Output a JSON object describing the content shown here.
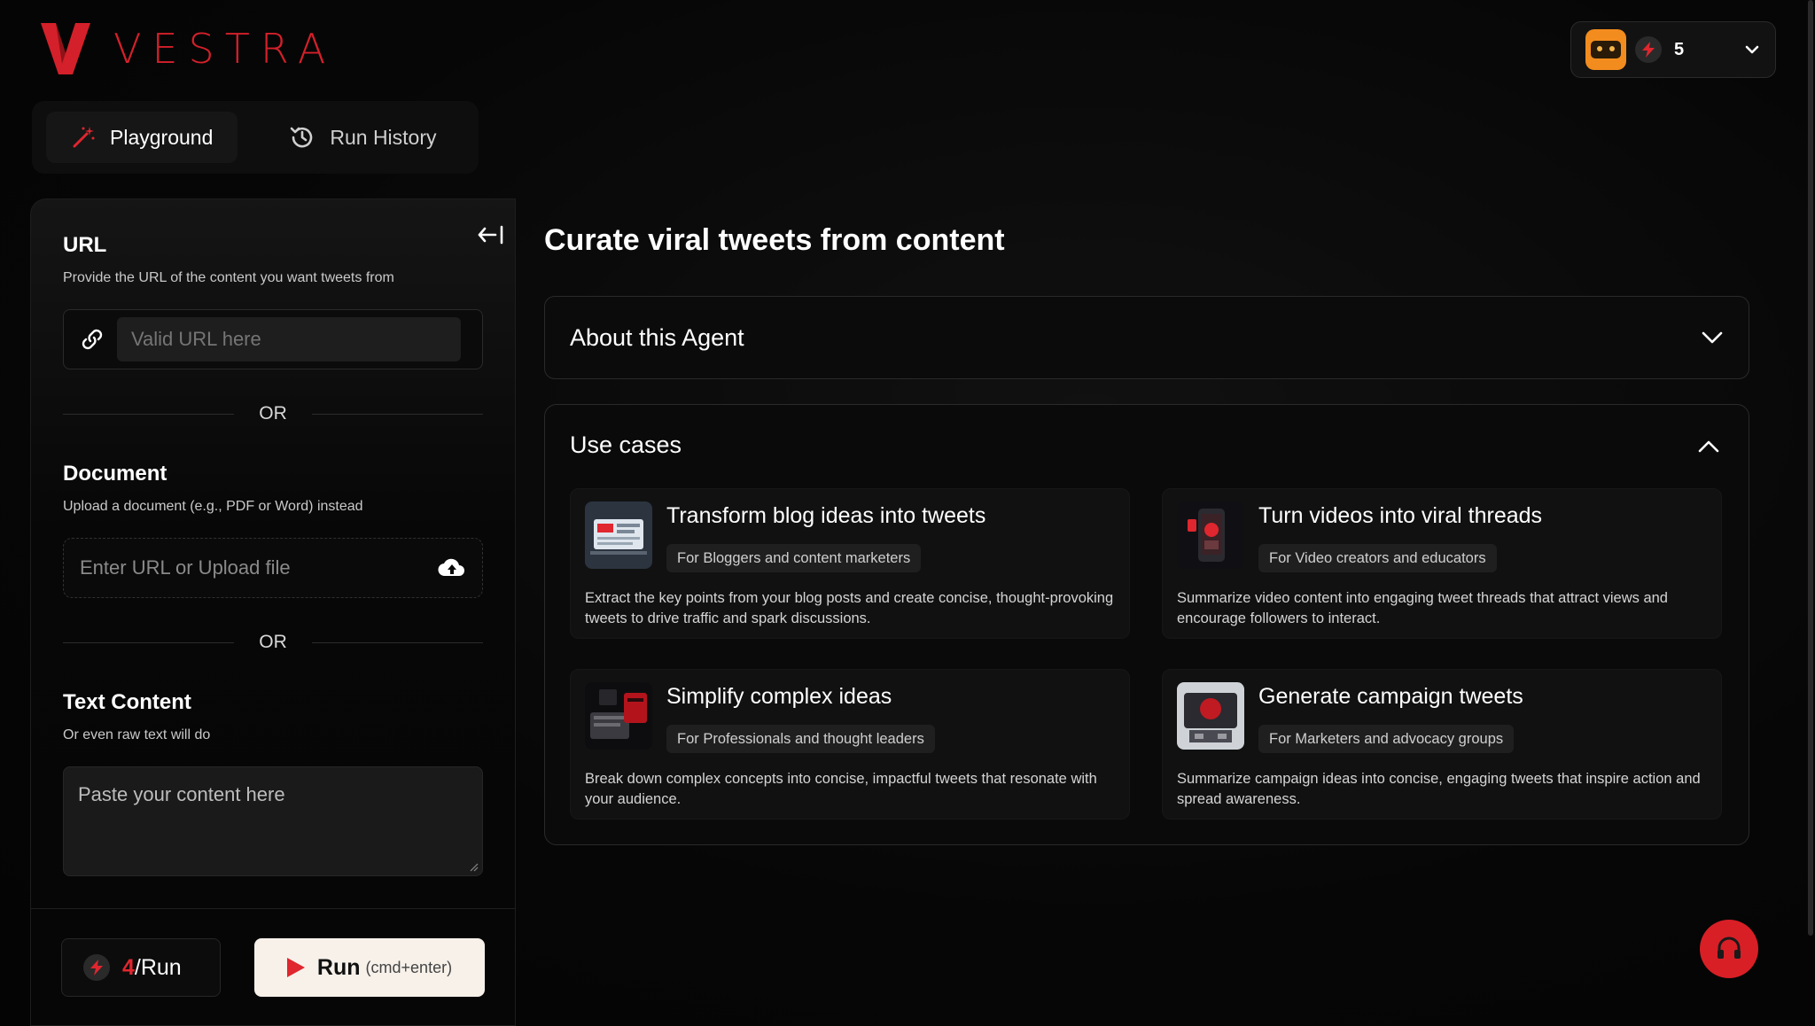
{
  "brand": {
    "name": "VESTRA",
    "accent": "#d4202a"
  },
  "account": {
    "credits": "5",
    "avatar_icon": "robot-avatar-icon"
  },
  "tabs": [
    {
      "label": "Playground",
      "icon": "magic-wand-icon",
      "active": true
    },
    {
      "label": "Run History",
      "icon": "history-icon",
      "active": false
    }
  ],
  "form": {
    "url": {
      "title": "URL",
      "subtitle": "Provide the URL of the content you want tweets from",
      "placeholder": "Valid URL here"
    },
    "or_label": "OR",
    "document": {
      "title": "Document",
      "subtitle": "Upload a document (e.g., PDF or Word) instead",
      "placeholder": "Enter URL or Upload file"
    },
    "text": {
      "title": "Text Content",
      "subtitle": "Or even raw text will do",
      "placeholder": "Paste your content here"
    }
  },
  "footer": {
    "cost_value": "4",
    "cost_suffix": "/Run",
    "run_label": "Run",
    "run_hint": "(cmd+enter)"
  },
  "main": {
    "title": "Curate viral tweets from content",
    "about_label": "About this Agent",
    "use_cases_label": "Use cases",
    "use_cases": [
      {
        "title": "Transform blog ideas into tweets",
        "tag": "For Bloggers and content marketers",
        "description": "Extract the key points from your blog posts and create concise, thought-provoking tweets to drive traffic and spark discussions."
      },
      {
        "title": "Turn videos into viral threads",
        "tag": "For Video creators and educators",
        "description": "Summarize video content into engaging tweet threads that attract views and encourage followers to interact."
      },
      {
        "title": "Simplify complex ideas",
        "tag": "For Professionals and thought leaders",
        "description": "Break down complex concepts into concise, impactful tweets that resonate with your audience."
      },
      {
        "title": "Generate campaign tweets",
        "tag": "For Marketers and advocacy groups",
        "description": "Summarize campaign ideas into concise, engaging tweets that inspire action and spread awareness."
      }
    ]
  }
}
